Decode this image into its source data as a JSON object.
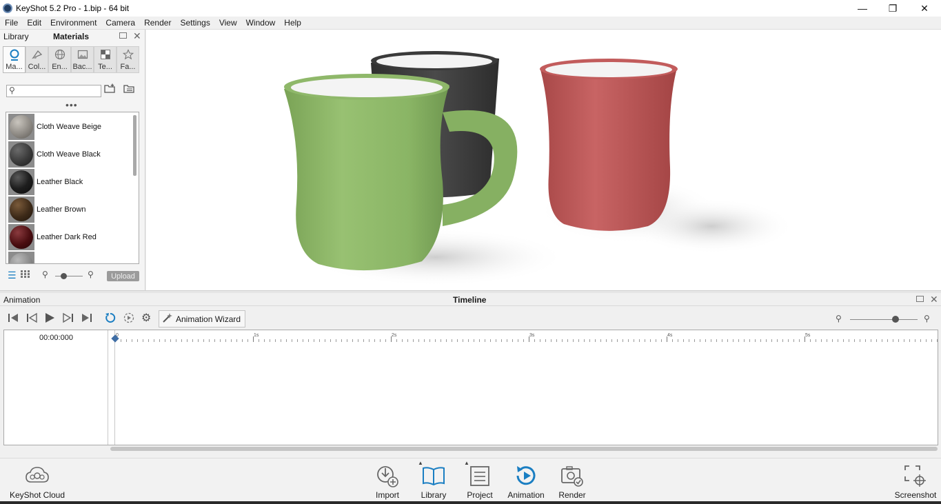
{
  "window": {
    "title": "KeyShot 5.2 Pro  - 1.bip  - 64 bit",
    "controls": {
      "minimize": "—",
      "maximize": "❐",
      "close": "✕"
    }
  },
  "menu": [
    "File",
    "Edit",
    "Environment",
    "Camera",
    "Render",
    "Settings",
    "View",
    "Window",
    "Help"
  ],
  "library": {
    "header": "Library",
    "panel_title": "Materials",
    "tabs": [
      {
        "label": "Ma...",
        "icon": "materials-icon",
        "active": true
      },
      {
        "label": "Col...",
        "icon": "colors-icon",
        "active": false
      },
      {
        "label": "En...",
        "icon": "environments-icon",
        "active": false
      },
      {
        "label": "Bac...",
        "icon": "backplates-icon",
        "active": false
      },
      {
        "label": "Te...",
        "icon": "textures-icon",
        "active": false
      },
      {
        "label": "Fa...",
        "icon": "favorites-icon",
        "active": false
      }
    ],
    "search": {
      "value": "",
      "placeholder": ""
    },
    "materials": [
      {
        "name": "Cloth Weave Beige",
        "color": "#8e8a84"
      },
      {
        "name": "Cloth Weave Black",
        "color": "#3a3a3a"
      },
      {
        "name": "Leather Black",
        "color": "#1e1e1e"
      },
      {
        "name": "Leather Brown",
        "color": "#3d2a18"
      },
      {
        "name": "Leather Dark Red",
        "color": "#4a0d10"
      }
    ],
    "footer": {
      "upload_label": "Upload"
    }
  },
  "animation": {
    "panel_label": "Animation",
    "panel_title": "Timeline",
    "wizard_label": "Animation Wizard",
    "current_time": "00:00:000",
    "ruler_labels": [
      "0",
      "1s",
      "2s",
      "3s",
      "4s",
      "5s"
    ]
  },
  "dock": {
    "cloud_label": "KeyShot Cloud",
    "items": [
      {
        "label": "Import",
        "icon": "import-icon"
      },
      {
        "label": "Library",
        "icon": "library-book-icon"
      },
      {
        "label": "Project",
        "icon": "project-icon"
      },
      {
        "label": "Animation",
        "icon": "animation-icon"
      },
      {
        "label": "Render",
        "icon": "render-icon"
      }
    ],
    "screenshot_label": "Screenshot"
  },
  "colors": {
    "accent": "#1a7ec2",
    "mug_green": "#8fb86a",
    "mug_dark": "#3e3e3e",
    "mug_red": "#c05b5b"
  }
}
